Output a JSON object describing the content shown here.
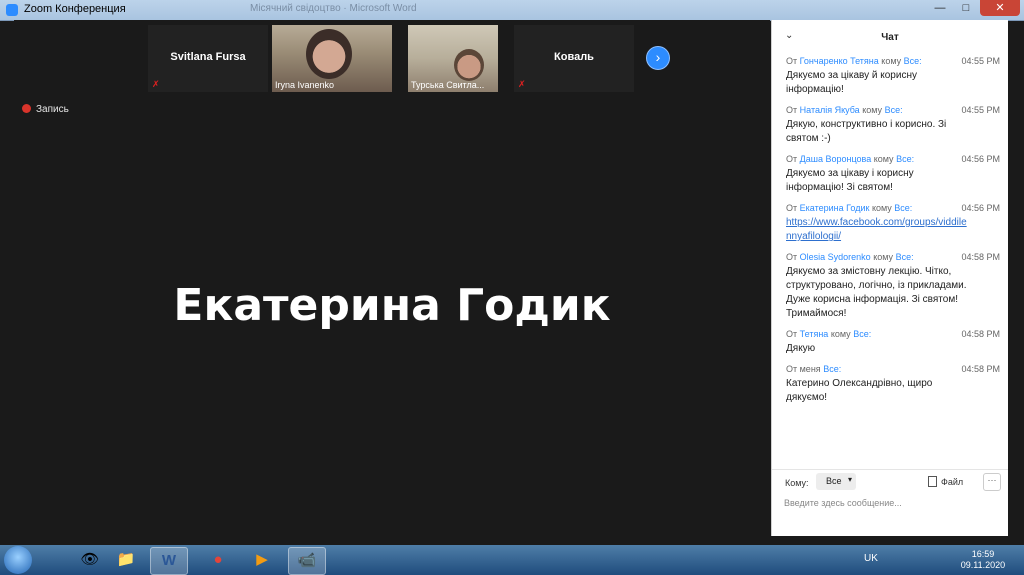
{
  "window": {
    "title": "Zoom Конференция",
    "faded_title": "Місячний свідоцтво · Microsoft Word"
  },
  "controls": {
    "minimize": "—",
    "maximize": "□",
    "close": "✕"
  },
  "tiles": [
    {
      "name": "Svitlana Fursa"
    },
    {
      "label": "Iryna Ivanenko"
    },
    {
      "label": "Турська Свитла..."
    },
    {
      "name": "Коваль"
    }
  ],
  "next_icon": "›",
  "recording": {
    "label": "Запись"
  },
  "active_speaker": "Екатерина Годик",
  "chat": {
    "title": "Чат",
    "collapse_icon": "⌄",
    "messages": [
      {
        "from": "От",
        "sender": "Гончаренко Тетяна",
        "to": "кому",
        "recipient": "Все:",
        "time": "04:55 PM",
        "line1": "Дякуємо за цікаву й корисну",
        "line2": "інформацію!",
        "line3": "",
        "line4": ""
      },
      {
        "from": "От",
        "sender": "Наталія Якуба",
        "to": "кому",
        "recipient": "Все:",
        "time": "04:55 PM",
        "line1": "Дякую, конструктивно і корисно. Зі",
        "line2": "святом :-)",
        "line3": "",
        "line4": ""
      },
      {
        "from": "От",
        "sender": "Даша Воронцова",
        "to": "кому",
        "recipient": "Все:",
        "time": "04:56 PM",
        "line1": "Дякуємо за цікаву і корисну",
        "line2": "інформацію! Зі святом!",
        "line3": "",
        "line4": ""
      },
      {
        "from": "От",
        "sender": "Екатерина Годик",
        "to": "кому",
        "recipient": "Все:",
        "time": "04:56 PM",
        "link1": "https://www.facebook.com/groups/viddile",
        "link2": "nnyafilologii/"
      },
      {
        "from": "От",
        "sender": "Olesia Sydorenko",
        "to": "кому",
        "recipient": "Все:",
        "time": "04:58 PM",
        "line1": "Дякуємо за змістовну лекцію. Чітко,",
        "line2": "структуровано, логічно, із прикладами.",
        "line3": "Дуже корисна інформація. Зі святом!",
        "line4": "Тримаймося!"
      },
      {
        "from": "От",
        "sender": "Тетяна",
        "to": "кому",
        "recipient": "Все:",
        "time": "04:58 PM",
        "line1": "Дякую",
        "line2": "",
        "line3": "",
        "line4": ""
      },
      {
        "from": "От меня",
        "sender": "",
        "to": "",
        "recipient": "Все:",
        "time": "04:58 PM",
        "line1": "Катерино Олександрівно, щиро",
        "line2": "дякуємо!",
        "line3": "",
        "line4": ""
      }
    ],
    "to_label": "Кому:",
    "to_value": "Все",
    "dropdown_icon": "▾",
    "file_label": "Файл",
    "more_label": "···",
    "input_placeholder": "Введите здесь сообщение..."
  },
  "taskbar": {
    "apps": [
      {
        "icon": "👁"
      },
      {
        "icon": "📁"
      },
      {
        "icon": "W"
      },
      {
        "icon": "●"
      },
      {
        "icon": "▶"
      },
      {
        "icon": "📹"
      }
    ],
    "language": "UK",
    "time": "16:59",
    "date": "09.11.2020"
  }
}
